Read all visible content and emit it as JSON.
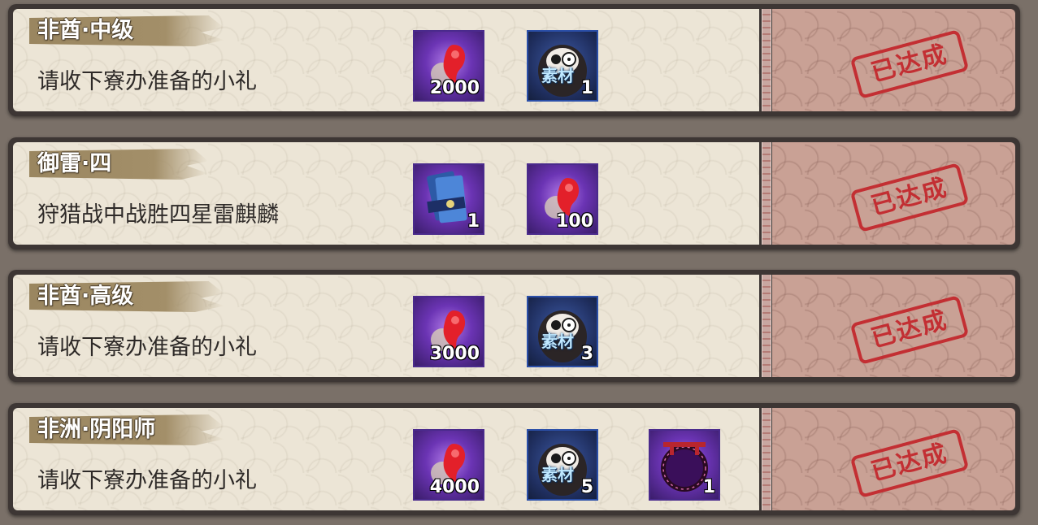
{
  "rows": [
    {
      "title": "非酋·中级",
      "description": "请收下寮办准备的小礼",
      "status": "已达成",
      "rewards": [
        {
          "icon": "magatama-jade-icon",
          "quantity": "2000",
          "style": "purple"
        },
        {
          "icon": "daruma-material-icon",
          "label": "素材",
          "quantity": "1",
          "style": "blue"
        }
      ]
    },
    {
      "title": "御雷·四",
      "description": "狩猎战中战胜四星雷麒麟",
      "status": "已达成",
      "rewards": [
        {
          "icon": "talisman-ticket-icon",
          "quantity": "1",
          "style": "purple"
        },
        {
          "icon": "magatama-jade-icon",
          "quantity": "100",
          "style": "purple"
        }
      ]
    },
    {
      "title": "非酋·高级",
      "description": "请收下寮办准备的小礼",
      "status": "已达成",
      "rewards": [
        {
          "icon": "magatama-jade-icon",
          "quantity": "3000",
          "style": "purple"
        },
        {
          "icon": "daruma-material-icon",
          "label": "素材",
          "quantity": "3",
          "style": "blue"
        }
      ]
    },
    {
      "title": "非洲·阴阳师",
      "description": "请收下寮办准备的小礼",
      "status": "已达成",
      "rewards": [
        {
          "icon": "magatama-jade-icon",
          "quantity": "4000",
          "style": "purple"
        },
        {
          "icon": "daruma-material-icon",
          "label": "素材",
          "quantity": "5",
          "style": "blue"
        },
        {
          "icon": "torii-ring-frame-icon",
          "quantity": "1",
          "style": "purple"
        }
      ]
    }
  ],
  "colors": {
    "panel": "#ece5d6",
    "frame": "#3d3634",
    "status_bg": "#c9a195",
    "stamp": "#c3262b",
    "title_brush": "#a38f69"
  }
}
